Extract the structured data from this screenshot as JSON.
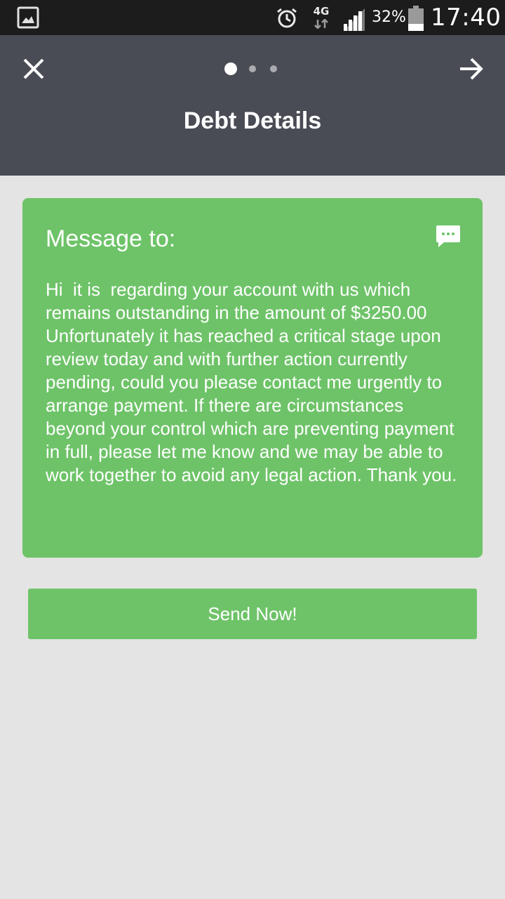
{
  "status_bar": {
    "network_type": "4G",
    "battery_percent": "32%",
    "battery_level": 0.32,
    "time": "17:40",
    "icons": [
      "gallery-icon",
      "alarm-icon",
      "data-arrows-icon",
      "signal-icon",
      "battery-icon"
    ]
  },
  "header": {
    "title": "Debt Details",
    "close_icon": "close-icon",
    "next_icon": "arrow-right-icon",
    "pager": {
      "total": 3,
      "active": 1
    }
  },
  "message_card": {
    "heading": "Message to:",
    "icon": "chat-icon",
    "body": "Hi  it is  regarding your account with us which remains outstanding in the amount of $3250.00 Unfortunately it has reached a critical stage upon review today and with further action currently pending, could you please contact me urgently to arrange payment. If there are circumstances beyond your control which are preventing payment in full, please let me know and we may be able to work together to avoid any legal action. Thank you."
  },
  "send_button": {
    "label": "Send Now!"
  },
  "colors": {
    "status_bar": "#1c1c1c",
    "header": "#494c54",
    "accent_green": "#6ec368",
    "background": "#e4e4e4"
  }
}
